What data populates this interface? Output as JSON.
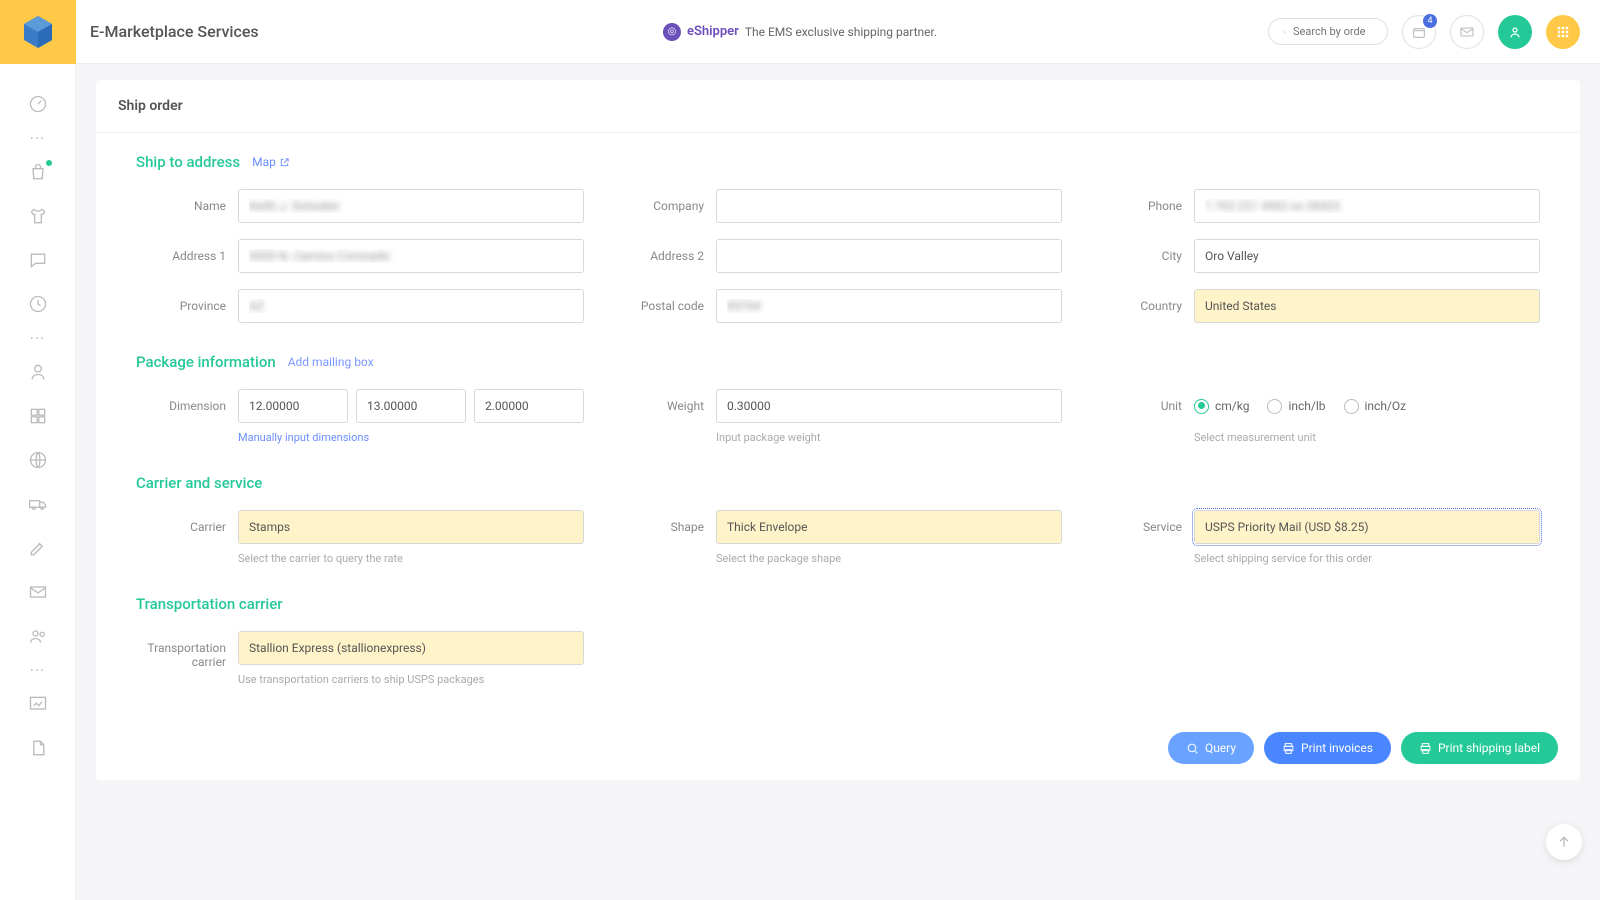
{
  "header": {
    "app_title": "E-Marketplace Services",
    "partner_name": "eShipper",
    "partner_tag": "The EMS exclusive shipping partner.",
    "search_placeholder": "Search by orde",
    "notification_count": "4"
  },
  "card": {
    "title": "Ship order"
  },
  "sections": {
    "ship_to": {
      "title": "Ship to address",
      "map_label": "Map"
    },
    "package": {
      "title": "Package information",
      "add_box": "Add mailing box"
    },
    "carrier": {
      "title": "Carrier and service"
    },
    "transport": {
      "title": "Transportation carrier"
    }
  },
  "labels": {
    "name": "Name",
    "company": "Company",
    "phone": "Phone",
    "address1": "Address 1",
    "address2": "Address 2",
    "city": "City",
    "province": "Province",
    "postal": "Postal code",
    "country": "Country",
    "dimension": "Dimension",
    "weight": "Weight",
    "unit": "Unit",
    "carrier": "Carrier",
    "shape": "Shape",
    "service": "Service",
    "trans_carrier": "Transportation carrier"
  },
  "values": {
    "name": "Keith J. Sotwater",
    "company": "",
    "phone": "1 702 221 4962 ex 28423",
    "address1": "0000 N. Camino Coronado",
    "address2": "",
    "city": "Oro Valley",
    "province": "AZ",
    "postal": "85704",
    "country": "United States",
    "dim_l": "12.00000",
    "dim_w": "13.00000",
    "dim_h": "2.00000",
    "weight": "0.30000",
    "carrier": "Stamps",
    "shape": "Thick Envelope",
    "service": "USPS Priority Mail (USD $8.25)",
    "trans_carrier": "Stallion Express (stallionexpress)"
  },
  "units": {
    "opt1": "cm/kg",
    "opt2": "inch/lb",
    "opt3": "inch/Oz",
    "selected": "cm/kg"
  },
  "hints": {
    "dim": "Manually input dimensions",
    "weight": "Input package weight",
    "unit": "Select measurement unit",
    "carrier": "Select the carrier to query the rate",
    "shape": "Select the package shape",
    "service": "Select shipping service for this order",
    "trans": "Use transportation carriers to ship USPS packages"
  },
  "buttons": {
    "query": "Query",
    "invoices": "Print invoices",
    "label": "Print shipping label"
  }
}
